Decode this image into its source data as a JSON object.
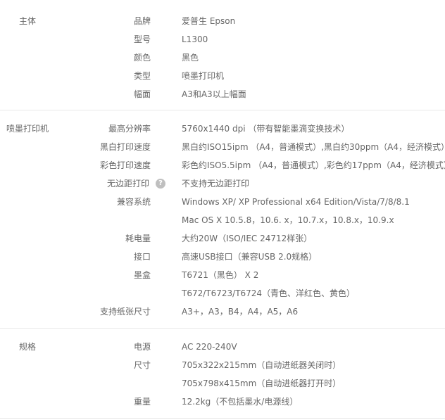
{
  "sections": [
    {
      "title": "主体",
      "rows": [
        {
          "label": "品牌",
          "value": "爱普生 Epson"
        },
        {
          "label": "型号",
          "value": "L1300"
        },
        {
          "label": "颜色",
          "value": "黑色"
        },
        {
          "label": "类型",
          "value": "喷墨打印机"
        },
        {
          "label": "幅面",
          "value": "A3和A3以上幅面"
        }
      ]
    },
    {
      "title": "喷墨打印机",
      "rows": [
        {
          "label": "最高分辨率",
          "value": "5760x1440 dpi （带有智能墨滴变换技术）"
        },
        {
          "label": "黑白打印速度",
          "value": "黑白约ISO15ipm （A4，普通模式）,黑白约30ppm（A4，经济模式）"
        },
        {
          "label": "彩色打印速度",
          "value": "彩色约ISO5.5ipm （A4，普通模式）,彩色约17ppm（A4，经济模式）"
        },
        {
          "label": "无边距打印",
          "value": "不支持无边距打印",
          "help_icon": "?"
        },
        {
          "label": "兼容系统",
          "value": "Windows XP/ XP Professional x64 Edition/Vista/7/8/8.1"
        },
        {
          "label": "",
          "value": "Mac OS X 10.5.8，10.6. x，10.7.x，10.8.x，10.9.x"
        },
        {
          "label": "耗电量",
          "value": "大约20W（ISO/IEC 24712样张）"
        },
        {
          "label": "接口",
          "value": "高速USB接口（兼容USB 2.0规格）"
        },
        {
          "label": "墨盒",
          "value": "T6721（黑色） X 2"
        },
        {
          "label": "",
          "value": "T672/T6723/T6724（青色、洋红色、黄色）"
        },
        {
          "label": "支持纸张尺寸",
          "value": "A3+，A3，B4，A4，A5，A6"
        }
      ]
    },
    {
      "title": "规格",
      "rows": [
        {
          "label": "电源",
          "value": "AC 220-240V"
        },
        {
          "label": "尺寸",
          "value": "705x322x215mm（自动进纸器关闭时）"
        },
        {
          "label": "",
          "value": "705x798x415mm（自动进纸器打开时）"
        },
        {
          "label": "重量",
          "value": "12.2kg（不包括墨水/电源线）"
        }
      ]
    }
  ]
}
